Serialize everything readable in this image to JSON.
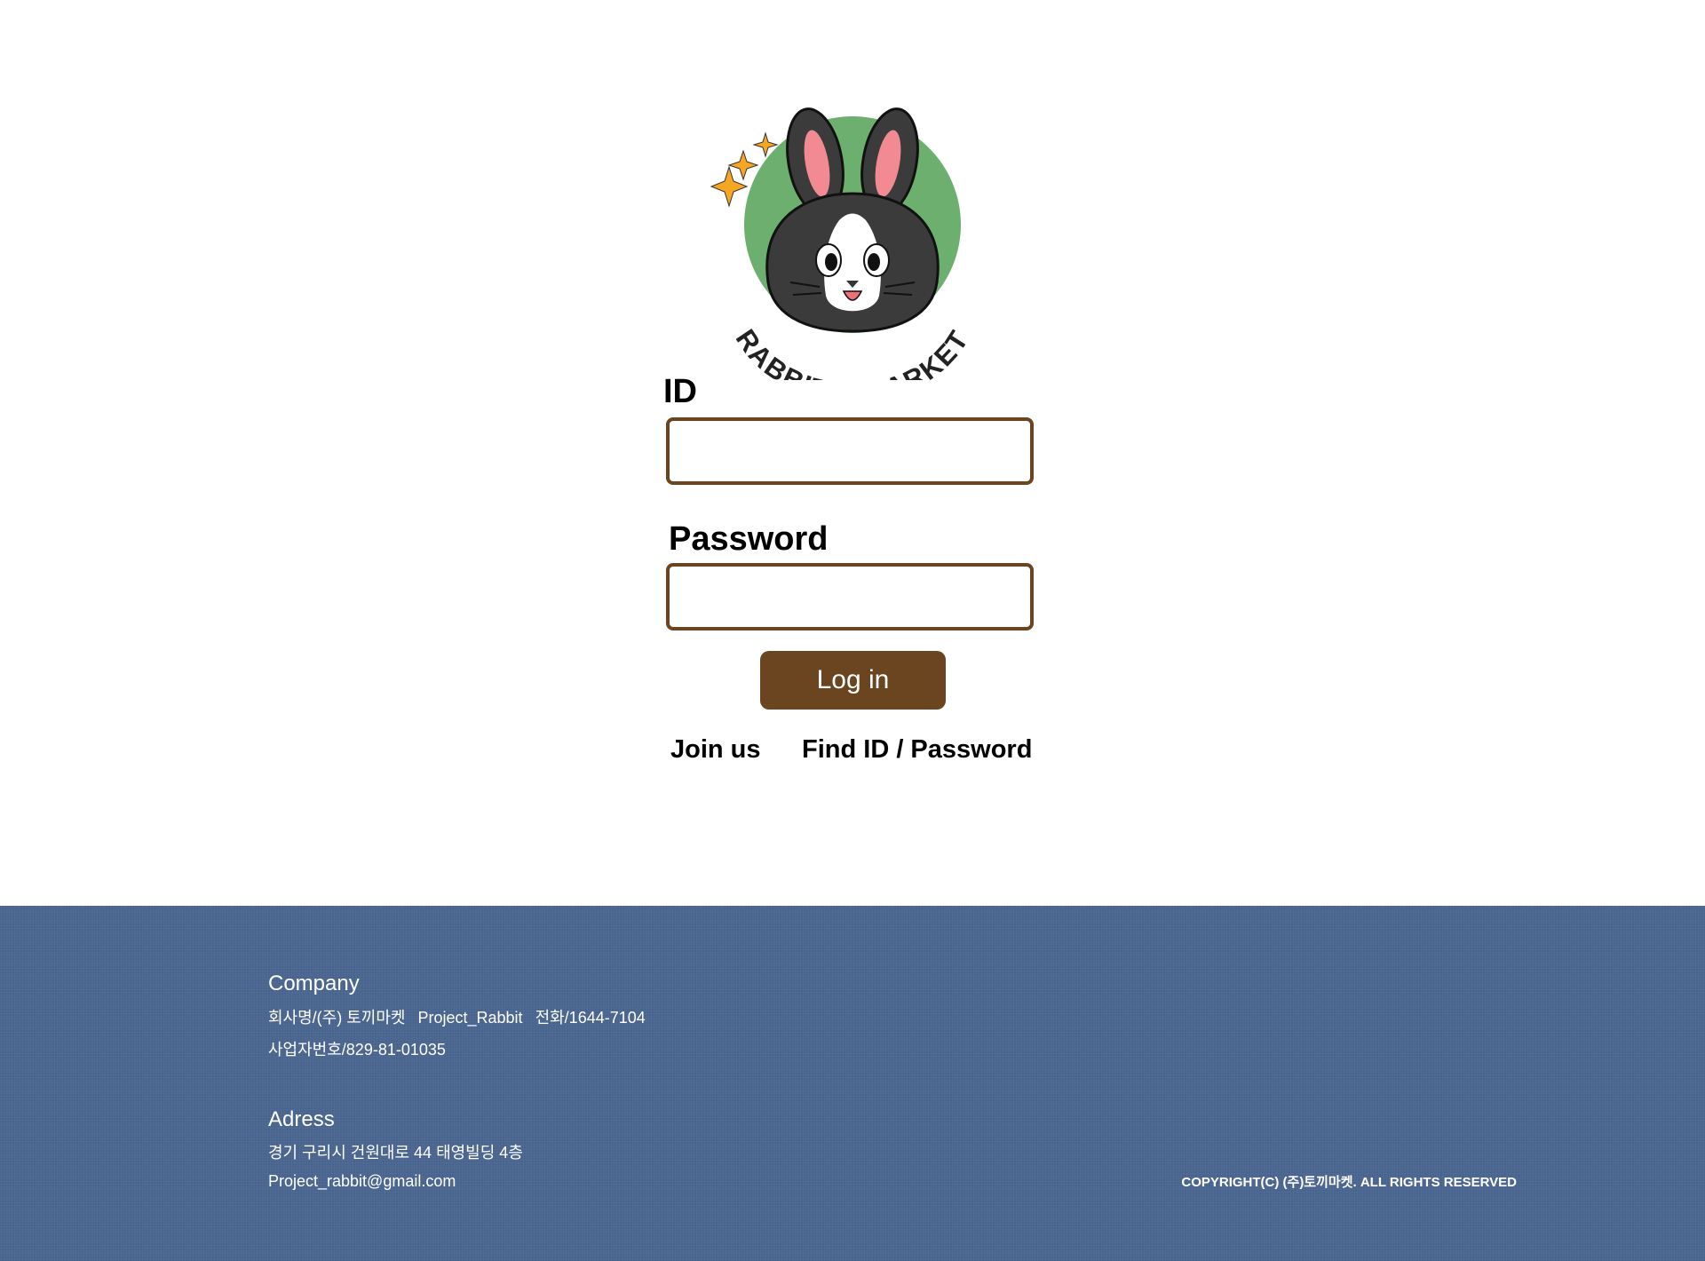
{
  "logo": {
    "text": "RABBIT'S MARKET",
    "colors": {
      "circle": "#6daf6f",
      "rabbit": "#3b3b3b",
      "ear_inner": "#f28a94",
      "sparkle": "#f5a623"
    }
  },
  "login_form": {
    "id_label": "ID",
    "id_value": "",
    "password_label": "Password",
    "password_value": "",
    "login_button": "Log in",
    "join_link": "Join us",
    "find_link": "Find ID / Password"
  },
  "footer": {
    "company_heading": "Company",
    "company_name": "회사명/(주) 토끼마켓",
    "project": "Project_Rabbit",
    "phone": "전화/1644-7104",
    "business_number": "사업자번호/829-81-01035",
    "adress_heading": "Adress",
    "address": "경기 구리시 건원대로 44 태영빌딩 4층",
    "email": "Project_rabbit@gmail.com",
    "copyright": "COPYRIGHT(C) (주)토끼마켓. ALL RIGHTS RESERVED"
  },
  "colors": {
    "accent": "#6b4420",
    "footer_bg": "#4a6690",
    "text": "#000000"
  }
}
